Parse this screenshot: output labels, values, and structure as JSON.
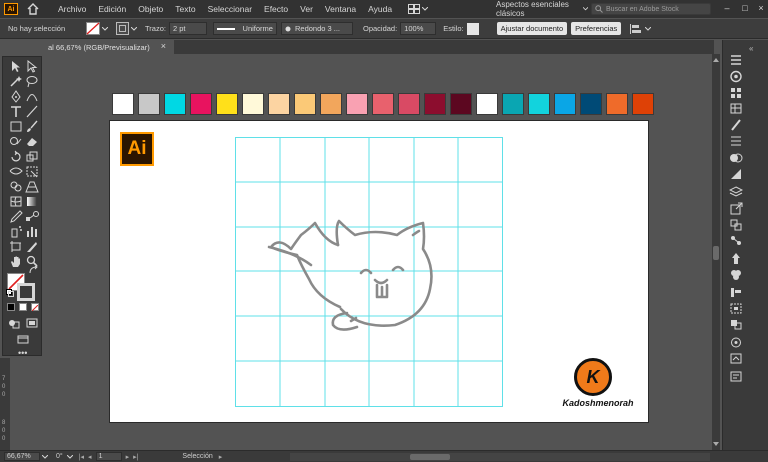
{
  "app": {
    "logo": "Ai",
    "menu": [
      "Archivo",
      "Edición",
      "Objeto",
      "Texto",
      "Seleccionar",
      "Efecto",
      "Ver",
      "Ventana",
      "Ayuda"
    ],
    "workspace": "Aspectos esenciales clásicos",
    "stock_search_placeholder": "Buscar en Adobe Stock"
  },
  "control_bar": {
    "selection_status": "No hay selección",
    "stroke_label": "Trazo:",
    "stroke_value": "2 pt",
    "profile_label": "Uniforme",
    "brush_label": "Redondo 3 ...",
    "opacity_label": "Opacidad:",
    "opacity_value": "100%",
    "style_label": "Estilo:",
    "adjust_doc_button": "Ajustar documento",
    "preferences_button": "Preferencias"
  },
  "document_tab": {
    "title": "al 66,67% (RGB/Previsualizar)",
    "close": "×"
  },
  "swatches": [
    "#ffffff",
    "#c8c8c8",
    "#00d8e4",
    "#e8135f",
    "#ffe01a",
    "#fff9d9",
    "#fcd4a2",
    "#fbc977",
    "#f2a65c",
    "#f9a1b2",
    "#e8616d",
    "#d94a64",
    "#8c0d2e",
    "#5c0720",
    "#ffffff",
    "#0aa6b2",
    "#12d3dd",
    "#0aa6e6",
    "#004a76",
    "#ef6b2a",
    "#de4106"
  ],
  "artboard": {
    "badge": "Ai",
    "signature_letter": "K",
    "signature_name": "Kadoshmenorah"
  },
  "status_bar": {
    "zoom": "66,67%",
    "angle": "0°",
    "artboard_number": "1",
    "tool_name": "Selección"
  },
  "ruler_marks": [
    "7",
    "0",
    "0",
    "8",
    "0",
    "0"
  ],
  "colors": {
    "accent": "#ff9a00",
    "grid": "#5fe0e8",
    "drawing": "#8a8a8a"
  }
}
